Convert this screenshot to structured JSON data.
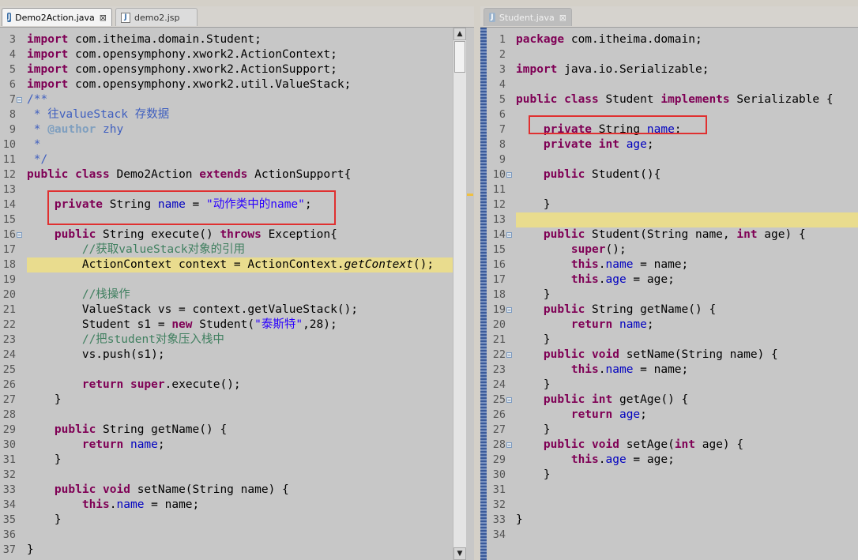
{
  "left_editor": {
    "tabs": [
      {
        "label": "Demo2Action.java",
        "close": "⊠",
        "active": true
      },
      {
        "label": "demo2.jsp",
        "close": "",
        "active": false
      }
    ],
    "lines": [
      {
        "no": "3",
        "tokens": [
          [
            "kw",
            "import"
          ],
          [
            "dflt",
            " com.itheima.domain.Student;"
          ]
        ]
      },
      {
        "no": "4",
        "tokens": [
          [
            "kw",
            "import"
          ],
          [
            "dflt",
            " com.opensymphony.xwork2.ActionContext;"
          ]
        ]
      },
      {
        "no": "5",
        "tokens": [
          [
            "kw",
            "import"
          ],
          [
            "dflt",
            " com.opensymphony.xwork2.ActionSupport;"
          ]
        ]
      },
      {
        "no": "6",
        "tokens": [
          [
            "kw",
            "import"
          ],
          [
            "dflt",
            " com.opensymphony.xwork2.util.ValueStack;"
          ]
        ]
      },
      {
        "no": "7",
        "tokens": [
          [
            "jd",
            "/**"
          ]
        ]
      },
      {
        "no": "8",
        "tokens": [
          [
            "jd",
            " * 往valueStack 存数据"
          ]
        ]
      },
      {
        "no": "9",
        "tokens": [
          [
            "jd",
            " * "
          ],
          [
            "jdtag",
            "@author"
          ],
          [
            "jd",
            " zhy"
          ]
        ]
      },
      {
        "no": "10",
        "tokens": [
          [
            "jd",
            " *"
          ]
        ]
      },
      {
        "no": "11",
        "tokens": [
          [
            "jd",
            " */"
          ]
        ]
      },
      {
        "no": "12",
        "tokens": [
          [
            "kw",
            "public class"
          ],
          [
            "dflt",
            " Demo2Action "
          ],
          [
            "kw",
            "extends"
          ],
          [
            "dflt",
            " ActionSupport{"
          ]
        ]
      },
      {
        "no": "13",
        "tokens": []
      },
      {
        "no": "14",
        "tokens": [
          [
            "dflt",
            "    "
          ],
          [
            "kw",
            "private"
          ],
          [
            "dflt",
            " String "
          ],
          [
            "fld",
            "name"
          ],
          [
            "dflt",
            " = "
          ],
          [
            "str",
            "\"动作类中的name\""
          ],
          [
            "dflt",
            ";"
          ]
        ]
      },
      {
        "no": "15",
        "tokens": []
      },
      {
        "no": "16",
        "tokens": [
          [
            "dflt",
            "    "
          ],
          [
            "kw",
            "public"
          ],
          [
            "dflt",
            " String execute() "
          ],
          [
            "kw",
            "throws"
          ],
          [
            "dflt",
            " Exception{"
          ]
        ]
      },
      {
        "no": "17",
        "tokens": [
          [
            "cm",
            "        //获取valueStack对象的引用"
          ]
        ]
      },
      {
        "no": "18",
        "tokens": [
          [
            "dflt",
            "        ActionContext context = ActionContext."
          ],
          [
            "it",
            "getContext"
          ],
          [
            "dflt",
            "();"
          ]
        ]
      },
      {
        "no": "19",
        "tokens": []
      },
      {
        "no": "20",
        "tokens": [
          [
            "cm",
            "        //栈操作"
          ]
        ]
      },
      {
        "no": "21",
        "tokens": [
          [
            "dflt",
            "        ValueStack vs = context.getValueStack();"
          ]
        ]
      },
      {
        "no": "22",
        "tokens": [
          [
            "dflt",
            "        Student s1 = "
          ],
          [
            "kw",
            "new"
          ],
          [
            "dflt",
            " Student("
          ],
          [
            "str",
            "\"泰斯特\""
          ],
          [
            "dflt",
            ",28);"
          ]
        ]
      },
      {
        "no": "23",
        "tokens": [
          [
            "cm",
            "        //把student对象压入栈中"
          ]
        ]
      },
      {
        "no": "24",
        "tokens": [
          [
            "dflt",
            "        vs.push(s1);"
          ]
        ]
      },
      {
        "no": "25",
        "tokens": []
      },
      {
        "no": "26",
        "tokens": [
          [
            "dflt",
            "        "
          ],
          [
            "kw",
            "return"
          ],
          [
            "dflt",
            " "
          ],
          [
            "kw",
            "super"
          ],
          [
            "dflt",
            ".execute();"
          ]
        ]
      },
      {
        "no": "27",
        "tokens": [
          [
            "dflt",
            "    }"
          ]
        ]
      },
      {
        "no": "28",
        "tokens": []
      },
      {
        "no": "29",
        "tokens": [
          [
            "dflt",
            "    "
          ],
          [
            "kw",
            "public"
          ],
          [
            "dflt",
            " String getName() {"
          ]
        ]
      },
      {
        "no": "30",
        "tokens": [
          [
            "dflt",
            "        "
          ],
          [
            "kw",
            "return"
          ],
          [
            "dflt",
            " "
          ],
          [
            "fld",
            "name"
          ],
          [
            "dflt",
            ";"
          ]
        ]
      },
      {
        "no": "31",
        "tokens": [
          [
            "dflt",
            "    }"
          ]
        ]
      },
      {
        "no": "32",
        "tokens": []
      },
      {
        "no": "33",
        "tokens": [
          [
            "dflt",
            "    "
          ],
          [
            "kw",
            "public"
          ],
          [
            "dflt",
            " "
          ],
          [
            "kw",
            "void"
          ],
          [
            "dflt",
            " setName(String name) {"
          ]
        ]
      },
      {
        "no": "34",
        "tokens": [
          [
            "dflt",
            "        "
          ],
          [
            "kw",
            "this"
          ],
          [
            "dflt",
            "."
          ],
          [
            "fld",
            "name"
          ],
          [
            "dflt",
            " = name;"
          ]
        ]
      },
      {
        "no": "35",
        "tokens": [
          [
            "dflt",
            "    }"
          ]
        ]
      },
      {
        "no": "36",
        "tokens": []
      },
      {
        "no": "37",
        "tokens": [
          [
            "dflt",
            "}"
          ]
        ]
      }
    ]
  },
  "right_editor": {
    "tabs": [
      {
        "label": "Student.java",
        "close": "⊠",
        "active": true
      }
    ],
    "lines": [
      {
        "no": "1",
        "tokens": [
          [
            "kw",
            "package"
          ],
          [
            "dflt",
            " com.itheima.domain;"
          ]
        ]
      },
      {
        "no": "2",
        "tokens": []
      },
      {
        "no": "3",
        "tokens": [
          [
            "kw",
            "import"
          ],
          [
            "dflt",
            " java.io.Serializable;"
          ]
        ]
      },
      {
        "no": "4",
        "tokens": []
      },
      {
        "no": "5",
        "tokens": [
          [
            "kw",
            "public class"
          ],
          [
            "dflt",
            " Student "
          ],
          [
            "kw",
            "implements"
          ],
          [
            "dflt",
            " Serializable {"
          ]
        ]
      },
      {
        "no": "6",
        "tokens": []
      },
      {
        "no": "7",
        "tokens": [
          [
            "dflt",
            "    "
          ],
          [
            "kw",
            "private"
          ],
          [
            "dflt",
            " String "
          ],
          [
            "fld",
            "name"
          ],
          [
            "dflt",
            ";"
          ]
        ]
      },
      {
        "no": "8",
        "tokens": [
          [
            "dflt",
            "    "
          ],
          [
            "kw",
            "private int"
          ],
          [
            "dflt",
            " "
          ],
          [
            "fld",
            "age"
          ],
          [
            "dflt",
            ";"
          ]
        ]
      },
      {
        "no": "9",
        "tokens": []
      },
      {
        "no": "10",
        "tokens": [
          [
            "dflt",
            "    "
          ],
          [
            "kw",
            "public"
          ],
          [
            "dflt",
            " Student(){"
          ]
        ]
      },
      {
        "no": "11",
        "tokens": []
      },
      {
        "no": "12",
        "tokens": [
          [
            "dflt",
            "    }"
          ]
        ]
      },
      {
        "no": "13",
        "tokens": []
      },
      {
        "no": "14",
        "tokens": [
          [
            "dflt",
            "    "
          ],
          [
            "kw",
            "public"
          ],
          [
            "dflt",
            " Student(String name, "
          ],
          [
            "kw",
            "int"
          ],
          [
            "dflt",
            " age) {"
          ]
        ]
      },
      {
        "no": "15",
        "tokens": [
          [
            "dflt",
            "        "
          ],
          [
            "kw",
            "super"
          ],
          [
            "dflt",
            "();"
          ]
        ]
      },
      {
        "no": "16",
        "tokens": [
          [
            "dflt",
            "        "
          ],
          [
            "kw",
            "this"
          ],
          [
            "dflt",
            "."
          ],
          [
            "fld",
            "name"
          ],
          [
            "dflt",
            " = name;"
          ]
        ]
      },
      {
        "no": "17",
        "tokens": [
          [
            "dflt",
            "        "
          ],
          [
            "kw",
            "this"
          ],
          [
            "dflt",
            "."
          ],
          [
            "fld",
            "age"
          ],
          [
            "dflt",
            " = age;"
          ]
        ]
      },
      {
        "no": "18",
        "tokens": [
          [
            "dflt",
            "    }"
          ]
        ]
      },
      {
        "no": "19",
        "tokens": [
          [
            "dflt",
            "    "
          ],
          [
            "kw",
            "public"
          ],
          [
            "dflt",
            " String getName() {"
          ]
        ]
      },
      {
        "no": "20",
        "tokens": [
          [
            "dflt",
            "        "
          ],
          [
            "kw",
            "return"
          ],
          [
            "dflt",
            " "
          ],
          [
            "fld",
            "name"
          ],
          [
            "dflt",
            ";"
          ]
        ]
      },
      {
        "no": "21",
        "tokens": [
          [
            "dflt",
            "    }"
          ]
        ]
      },
      {
        "no": "22",
        "tokens": [
          [
            "dflt",
            "    "
          ],
          [
            "kw",
            "public"
          ],
          [
            "dflt",
            " "
          ],
          [
            "kw",
            "void"
          ],
          [
            "dflt",
            " setName(String name) {"
          ]
        ]
      },
      {
        "no": "23",
        "tokens": [
          [
            "dflt",
            "        "
          ],
          [
            "kw",
            "this"
          ],
          [
            "dflt",
            "."
          ],
          [
            "fld",
            "name"
          ],
          [
            "dflt",
            " = name;"
          ]
        ]
      },
      {
        "no": "24",
        "tokens": [
          [
            "dflt",
            "    }"
          ]
        ]
      },
      {
        "no": "25",
        "tokens": [
          [
            "dflt",
            "    "
          ],
          [
            "kw",
            "public int"
          ],
          [
            "dflt",
            " getAge() {"
          ]
        ]
      },
      {
        "no": "26",
        "tokens": [
          [
            "dflt",
            "        "
          ],
          [
            "kw",
            "return"
          ],
          [
            "dflt",
            " "
          ],
          [
            "fld",
            "age"
          ],
          [
            "dflt",
            ";"
          ]
        ]
      },
      {
        "no": "27",
        "tokens": [
          [
            "dflt",
            "    }"
          ]
        ]
      },
      {
        "no": "28",
        "tokens": [
          [
            "dflt",
            "    "
          ],
          [
            "kw",
            "public"
          ],
          [
            "dflt",
            " "
          ],
          [
            "kw",
            "void"
          ],
          [
            "dflt",
            " setAge("
          ],
          [
            "kw",
            "int"
          ],
          [
            "dflt",
            " age) {"
          ]
        ]
      },
      {
        "no": "29",
        "tokens": [
          [
            "dflt",
            "        "
          ],
          [
            "kw",
            "this"
          ],
          [
            "dflt",
            "."
          ],
          [
            "fld",
            "age"
          ],
          [
            "dflt",
            " = age;"
          ]
        ]
      },
      {
        "no": "30",
        "tokens": [
          [
            "dflt",
            "    }"
          ]
        ]
      },
      {
        "no": "31",
        "tokens": []
      },
      {
        "no": "32",
        "tokens": []
      },
      {
        "no": "33",
        "tokens": [
          [
            "dflt",
            "}"
          ]
        ]
      },
      {
        "no": "34",
        "tokens": []
      }
    ]
  },
  "colors": {
    "keyword": "#7f0055",
    "field": "#0000c0",
    "string": "#2a00ff",
    "comment": "#3f7f5f",
    "javadoc": "#3f5fbf",
    "current_line": "#e9dc8e",
    "annotation_box": "#e03030"
  }
}
